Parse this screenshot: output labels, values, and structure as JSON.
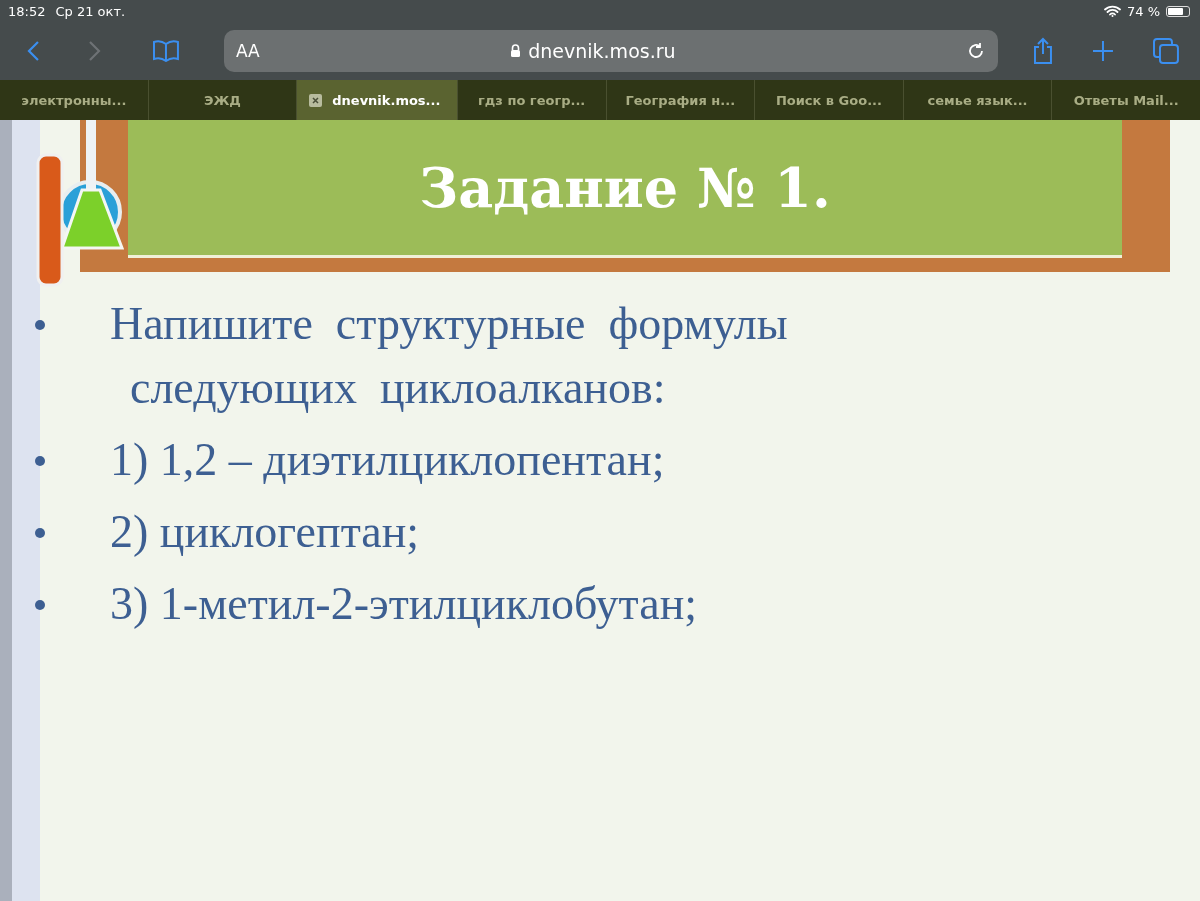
{
  "status_bar": {
    "time": "18:52",
    "date": "Ср 21 окт.",
    "battery_text": "74 %"
  },
  "address_bar": {
    "text_size_label": "AA",
    "url": "dnevnik.mos.ru"
  },
  "tabs": [
    {
      "label": "электронны...",
      "selected": false
    },
    {
      "label": "ЭЖД",
      "selected": false
    },
    {
      "label": "dnevnik.mos...",
      "selected": true
    },
    {
      "label": "гдз по геогр...",
      "selected": false
    },
    {
      "label": "География н...",
      "selected": false
    },
    {
      "label": "Поиск в Goo...",
      "selected": false
    },
    {
      "label": "семье язык...",
      "selected": false
    },
    {
      "label": "Ответы Mail...",
      "selected": false
    }
  ],
  "slide": {
    "title": "Задание  № 1.",
    "bullets": [
      {
        "lines": [
          "Напишите  структурные  формулы",
          "следующих  циклоалканов:"
        ]
      },
      {
        "lines": [
          "1) 1,2 – диэтилциклопентан;"
        ]
      },
      {
        "lines": [
          "2) циклогептан;"
        ]
      },
      {
        "lines": [
          "3) 1-метил-2-этилциклобутан;"
        ]
      }
    ]
  }
}
